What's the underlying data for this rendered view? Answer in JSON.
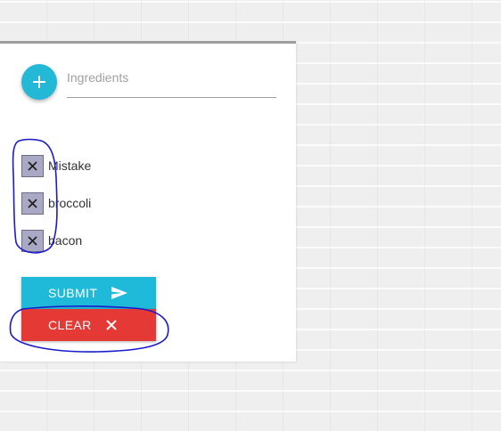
{
  "form": {
    "add_button_symbol": "+",
    "ingredient_input": {
      "placeholder": "Ingredients",
      "value": ""
    },
    "add_icon": "plus-icon"
  },
  "ingredients": [
    {
      "label": "Mistake",
      "delete_icon": "close-icon"
    },
    {
      "label": "broccoli",
      "delete_icon": "close-icon"
    },
    {
      "label": "bacon",
      "delete_icon": "close-icon"
    }
  ],
  "actions": {
    "submit": {
      "label": "SUBMIT",
      "icon": "send-icon",
      "color": "#1fb9d9"
    },
    "clear": {
      "label": "CLEAR",
      "icon": "close-icon",
      "color": "#e53935"
    }
  },
  "colors": {
    "accent": "#22b8d6",
    "annotation": "#1a1acb"
  }
}
